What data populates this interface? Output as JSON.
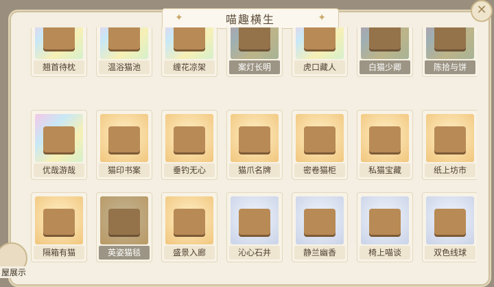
{
  "window": {
    "title": "喵趣横生",
    "close_icon": "close-icon"
  },
  "items": [
    {
      "label": "翘首待枕",
      "bg": "rainbow",
      "owned": false
    },
    {
      "label": "温浴猫池",
      "bg": "rainbow",
      "owned": false
    },
    {
      "label": "缠花凉架",
      "bg": "rainbow",
      "owned": false
    },
    {
      "label": "案灯长明",
      "bg": "rainbow",
      "owned": true
    },
    {
      "label": "虎口藏人",
      "bg": "rainbow",
      "owned": false
    },
    {
      "label": "白猫少卿",
      "bg": "rainbow",
      "owned": true
    },
    {
      "label": "陈拾与饼",
      "bg": "rainbow",
      "owned": true
    },
    {
      "label": "优哉游哉",
      "bg": "rainbow",
      "owned": false
    },
    {
      "label": "猫印书案",
      "bg": "gold",
      "owned": false
    },
    {
      "label": "垂钓无心",
      "bg": "gold",
      "owned": false
    },
    {
      "label": "猫爪名牌",
      "bg": "gold",
      "owned": false
    },
    {
      "label": "密卷猫柜",
      "bg": "gold",
      "owned": false
    },
    {
      "label": "私猫宝藏",
      "bg": "gold",
      "owned": false
    },
    {
      "label": "纸上坊市",
      "bg": "gold",
      "owned": false
    },
    {
      "label": "隔箱有猫",
      "bg": "gold",
      "owned": false
    },
    {
      "label": "英姿猫毯",
      "bg": "gold",
      "owned": true
    },
    {
      "label": "盛景入廊",
      "bg": "gold",
      "owned": false
    },
    {
      "label": "沁心石井",
      "bg": "blue",
      "owned": false
    },
    {
      "label": "静兰幽香",
      "bg": "blue",
      "owned": false
    },
    {
      "label": "椅上喵谈",
      "bg": "blue",
      "owned": false
    },
    {
      "label": "双色线球",
      "bg": "blue",
      "owned": false
    }
  ],
  "corner": {
    "label": "屋展示"
  }
}
